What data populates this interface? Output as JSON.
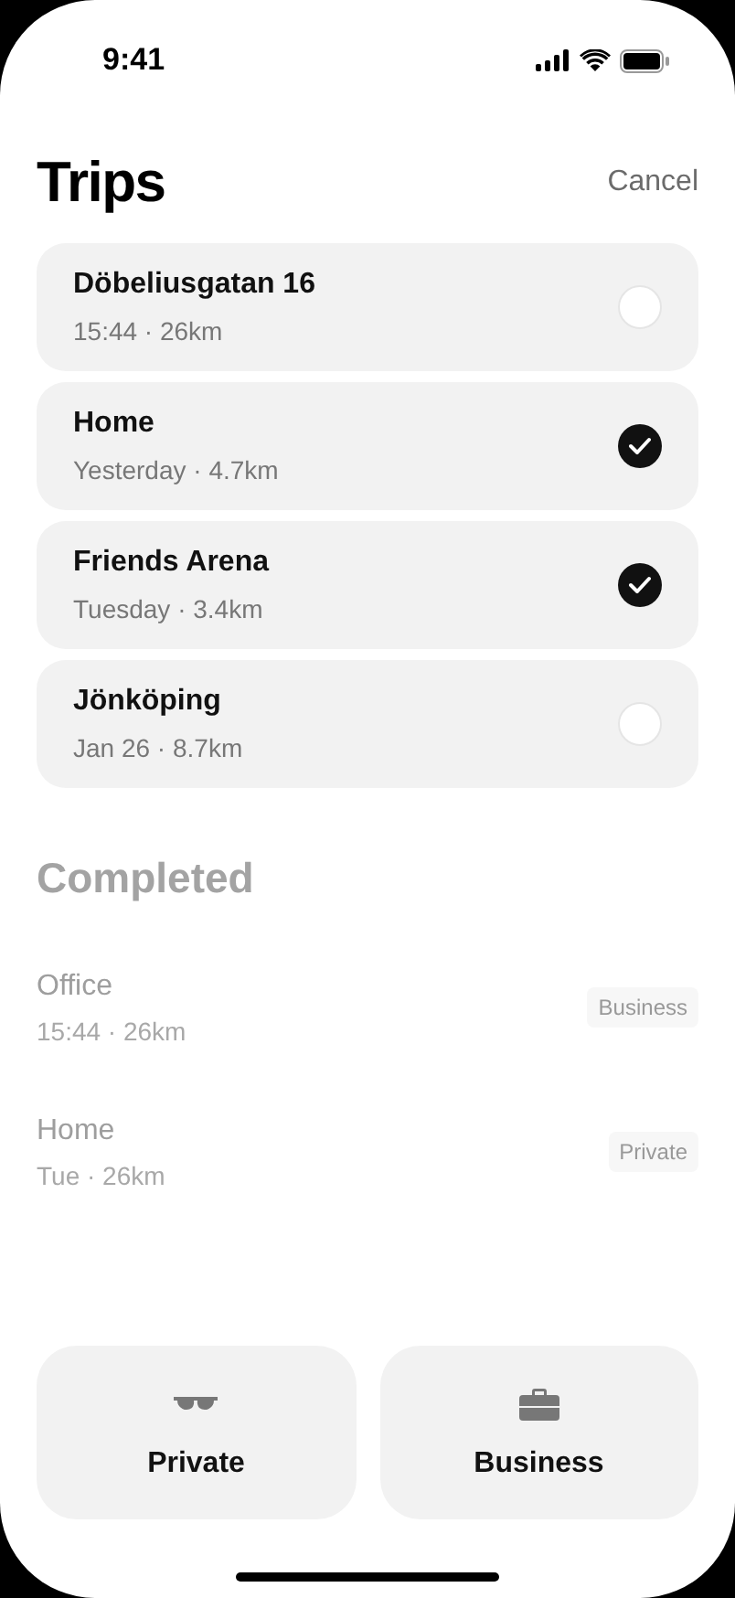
{
  "status_bar": {
    "time": "9:41"
  },
  "header": {
    "title": "Trips",
    "action": "Cancel"
  },
  "trips": [
    {
      "name": "Döbeliusgatan 16",
      "detail": "15:44 · 26km",
      "selected": false
    },
    {
      "name": "Home",
      "detail": "Yesterday · 4.7km",
      "selected": true
    },
    {
      "name": "Friends Arena",
      "detail": "Tuesday · 3.4km",
      "selected": true
    },
    {
      "name": "Jönköping",
      "detail": "Jan 26 · 8.7km",
      "selected": false
    }
  ],
  "completed": {
    "title": "Completed",
    "items": [
      {
        "name": "Office",
        "detail": "15:44 · 26km",
        "tag": "Business"
      },
      {
        "name": "Home",
        "detail": "Tue · 26km",
        "tag": "Private"
      }
    ]
  },
  "actions": [
    {
      "kind": "private",
      "label": "Private"
    },
    {
      "kind": "business",
      "label": "Business"
    }
  ]
}
